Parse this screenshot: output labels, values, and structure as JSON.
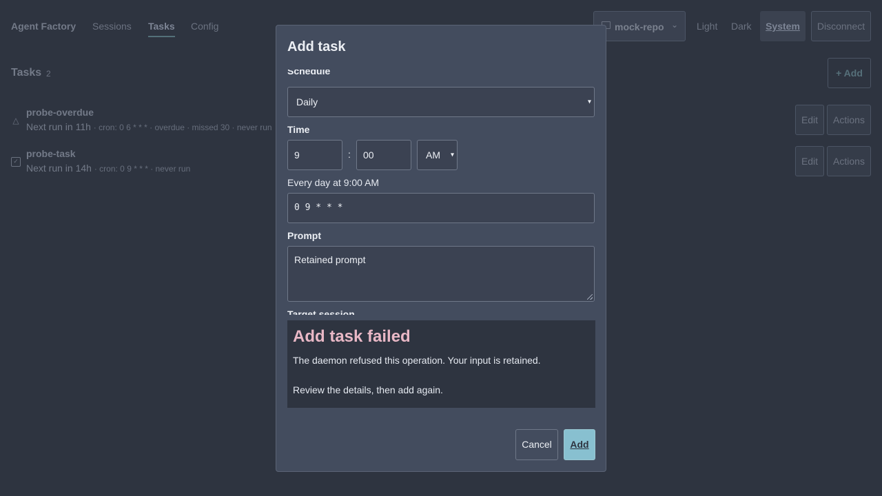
{
  "header": {
    "brand": "Agent Factory",
    "nav": [
      "Sessions",
      "Tasks",
      "Config"
    ],
    "repo": "mock-repo",
    "themes": [
      "Light",
      "Dark",
      "System"
    ],
    "disconnect": "Disconnect"
  },
  "tasks_page": {
    "title": "Tasks",
    "count": "2",
    "add_label": "+ Add",
    "rows": [
      {
        "icon": "warning-icon",
        "name": "probe-overdue",
        "next_run": "Next run in 11h",
        "details": "· cron: 0 6 * * * · overdue · missed 30 · never run",
        "edit": "Edit",
        "actions": "Actions"
      },
      {
        "icon": "checkbox-icon",
        "name": "probe-task",
        "next_run": "Next run in 14h",
        "details": "· cron: 0 9 * * * · never run",
        "edit": "Edit",
        "actions": "Actions"
      }
    ]
  },
  "modal": {
    "title": "Add task",
    "schedule_label": "Schedule",
    "schedule_value": "Daily",
    "time_label": "Time",
    "hour": "9",
    "minute": "00",
    "ampm": "AM",
    "separator": ":",
    "summary": "Every day at 9:00 AM",
    "cron": "0 9 * * *",
    "prompt_label": "Prompt",
    "prompt_value": "Retained prompt",
    "target_label": "Target session",
    "error": {
      "title": "Add task failed",
      "message": "The daemon refused this operation. Your input is retained.",
      "hint": "Review the details, then add again."
    },
    "cancel": "Cancel",
    "submit": "Add"
  },
  "colors": {
    "background": "#2e3440",
    "modal": "#434c5e",
    "accent": "#88c0d0",
    "error_title": "#e9b8c6"
  }
}
